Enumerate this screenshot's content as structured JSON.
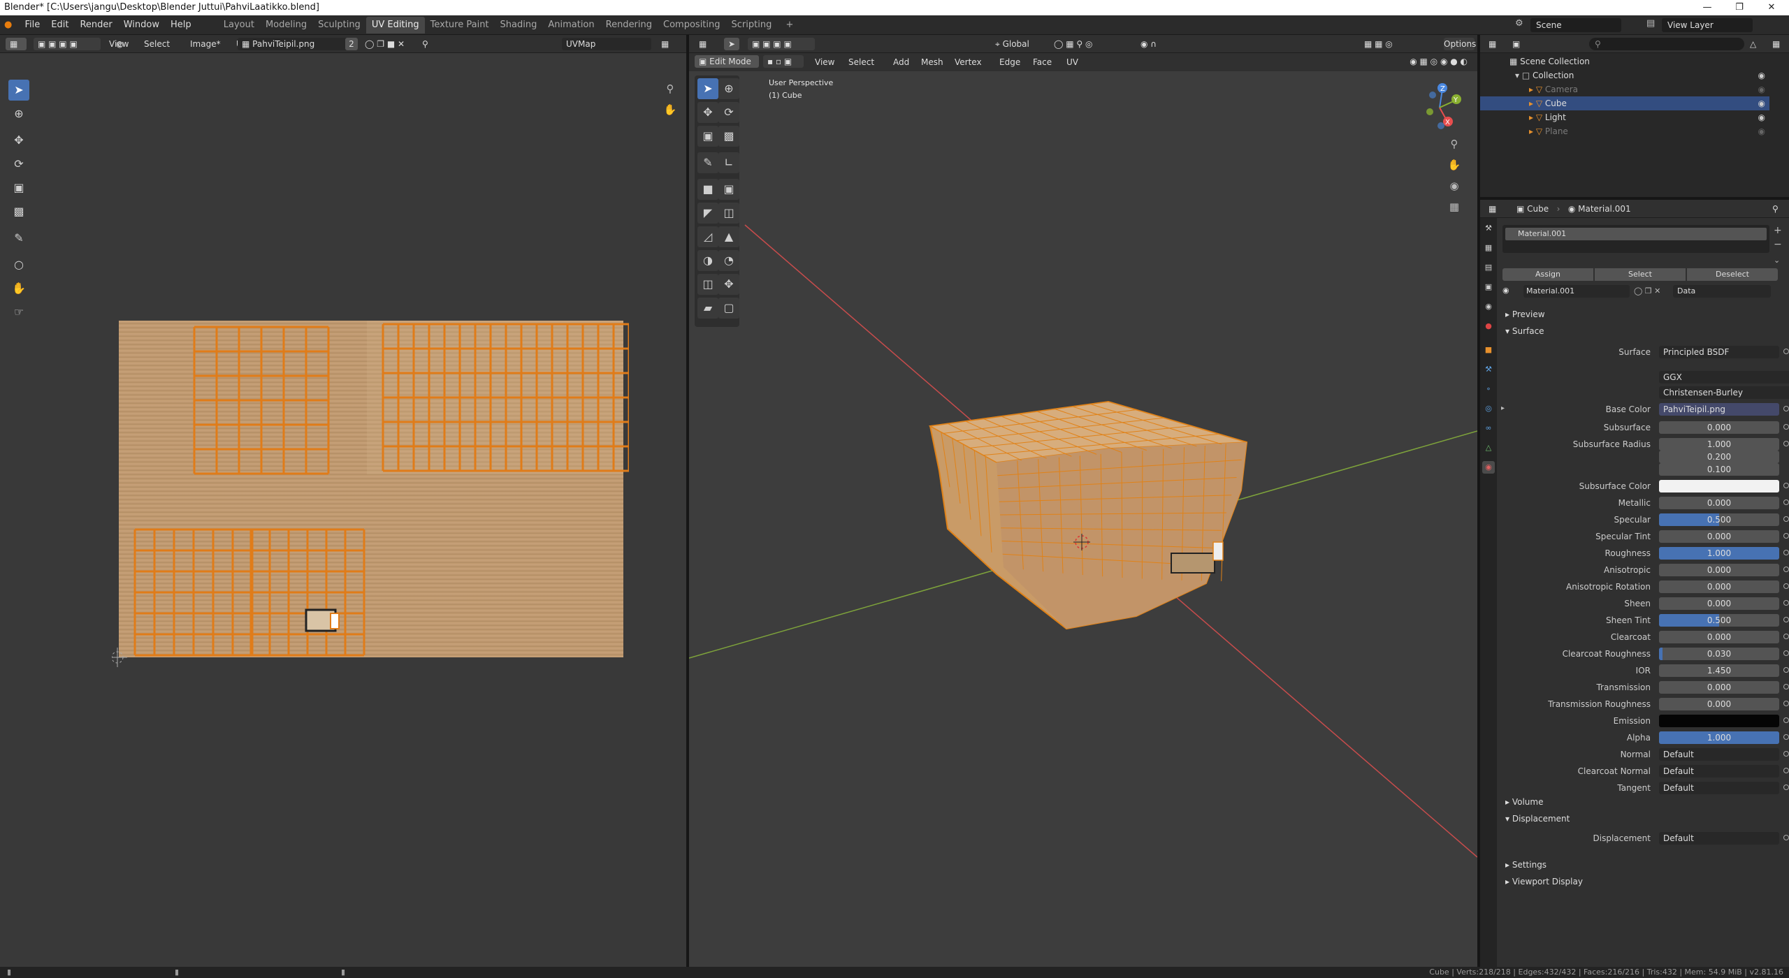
{
  "window": {
    "title": "Blender* [C:\\Users\\jangu\\Desktop\\Blender Juttui\\PahviLaatikko.blend]"
  },
  "menus": [
    "File",
    "Edit",
    "Render",
    "Window",
    "Help"
  ],
  "workspaces": [
    "Layout",
    "Modeling",
    "Sculpting",
    "UV Editing",
    "Texture Paint",
    "Shading",
    "Animation",
    "Rendering",
    "Compositing",
    "Scripting"
  ],
  "workspace_active": "UV Editing",
  "workspace_add": "+",
  "scene": {
    "name": "Scene",
    "view_layer": "View Layer"
  },
  "uv_editor": {
    "menus": [
      "View",
      "Select",
      "Image*",
      "UV"
    ],
    "image_name": "PahviTeipil.png",
    "users": "2",
    "uvmap": "UVMap"
  },
  "viewport": {
    "mode": "Edit Mode",
    "menus": [
      "View",
      "Select",
      "Add",
      "Mesh",
      "Vertex",
      "Edge",
      "Face",
      "UV"
    ],
    "orientation": "Global",
    "options_label": "Options",
    "overlay_title": "User Perspective",
    "overlay_object": "(1) Cube",
    "gizmo": {
      "x": "X",
      "y": "Y",
      "z": "Z"
    }
  },
  "outliner": {
    "root": "Scene Collection",
    "items": [
      {
        "name": "Collection",
        "indent": 1,
        "dim": false,
        "selected": false
      },
      {
        "name": "Camera",
        "indent": 2,
        "dim": true,
        "selected": false
      },
      {
        "name": "Cube",
        "indent": 2,
        "dim": false,
        "selected": true
      },
      {
        "name": "Light",
        "indent": 2,
        "dim": false,
        "selected": false
      },
      {
        "name": "Plane",
        "indent": 2,
        "dim": true,
        "selected": false
      }
    ]
  },
  "properties": {
    "breadcrumb_object": "Cube",
    "breadcrumb_material": "Material.001",
    "slot_name": "Material.001",
    "assign": "Assign",
    "select": "Select",
    "deselect": "Deselect",
    "material_name": "Material.001",
    "link": "Data",
    "panels": {
      "preview": "Preview",
      "surface": "Surface",
      "volume": "Volume",
      "displacement": "Displacement",
      "settings": "Settings",
      "viewport_display": "Viewport Display"
    },
    "surface_label": "Surface",
    "surface_value": "Principled BSDF",
    "distribution": "GGX",
    "subsurface_method": "Christensen-Burley",
    "base_color_label": "Base Color",
    "base_color_value": "PahviTeipil.png",
    "rows": [
      {
        "label": "Subsurface",
        "value": "0.000",
        "fill": 0
      },
      {
        "label": "Subsurface Radius",
        "value": "1.000",
        "fill": 0
      },
      {
        "label": "",
        "value": "0.200",
        "fill": 0
      },
      {
        "label": "",
        "value": "0.100",
        "fill": 0
      },
      {
        "label": "Subsurface Color",
        "value": "",
        "fill": 0,
        "swatch": "#f2f2f2"
      },
      {
        "label": "Metallic",
        "value": "0.000",
        "fill": 0
      },
      {
        "label": "Specular",
        "value": "0.500",
        "fill": 0.5
      },
      {
        "label": "Specular Tint",
        "value": "0.000",
        "fill": 0
      },
      {
        "label": "Roughness",
        "value": "1.000",
        "fill": 1
      },
      {
        "label": "Anisotropic",
        "value": "0.000",
        "fill": 0
      },
      {
        "label": "Anisotropic Rotation",
        "value": "0.000",
        "fill": 0
      },
      {
        "label": "Sheen",
        "value": "0.000",
        "fill": 0
      },
      {
        "label": "Sheen Tint",
        "value": "0.500",
        "fill": 0.5
      },
      {
        "label": "Clearcoat",
        "value": "0.000",
        "fill": 0
      },
      {
        "label": "Clearcoat Roughness",
        "value": "0.030",
        "fill": 0.03
      },
      {
        "label": "IOR",
        "value": "1.450",
        "fill": 0
      },
      {
        "label": "Transmission",
        "value": "0.000",
        "fill": 0
      },
      {
        "label": "Transmission Roughness",
        "value": "0.000",
        "fill": 0
      },
      {
        "label": "Emission",
        "value": "",
        "fill": 0,
        "swatch": "#050505"
      },
      {
        "label": "Alpha",
        "value": "1.000",
        "fill": 1
      },
      {
        "label": "Normal",
        "value": "Default",
        "fill": 0,
        "left": true
      },
      {
        "label": "Clearcoat Normal",
        "value": "Default",
        "fill": 0,
        "left": true
      },
      {
        "label": "Tangent",
        "value": "Default",
        "fill": 0,
        "left": true
      }
    ],
    "displacement_label": "Displacement",
    "displacement_value": "Default"
  },
  "status": "Cube | Verts:218/218 | Edges:432/432 | Faces:216/216 | Tris:432 | Mem: 54.9 MiB | v2.81.16",
  "colors": {
    "accent": "#4772b3",
    "edge_select": "#ff8c1a",
    "background": "#393939"
  }
}
